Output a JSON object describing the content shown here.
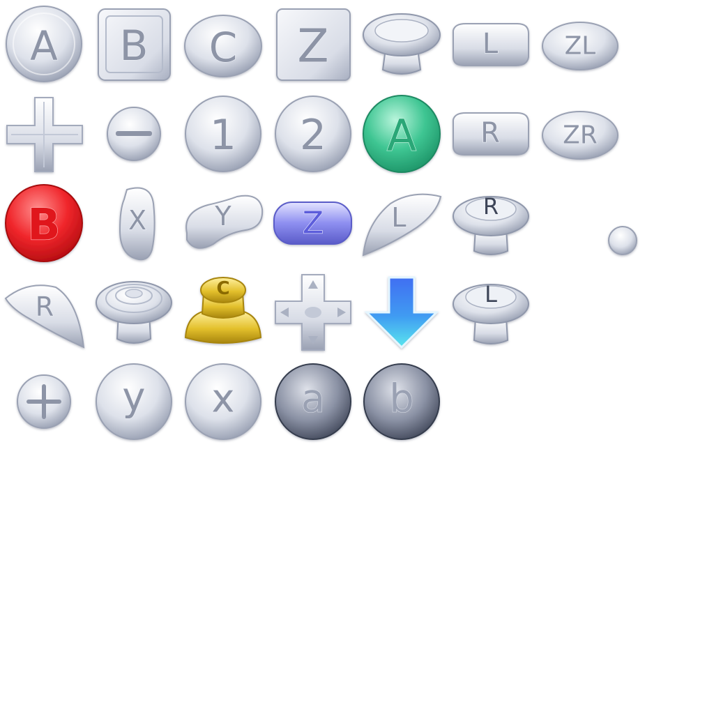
{
  "sheet": {
    "background": "#ffffff",
    "colors": {
      "silver": "#d9dde8",
      "silver_shade": "#8f97ab",
      "green": "#3ec592",
      "red": "#f0262b",
      "violet": "#8e8ff0",
      "yellow": "#e3c02c",
      "blue": "#3f86f2",
      "cyan": "#5ae6ee",
      "dark": "#4e5569"
    },
    "rows": [
      [
        {
          "name": "a-button-icon",
          "label": "A"
        },
        {
          "name": "b-square-button-icon",
          "label": "B"
        },
        {
          "name": "c-oval-button-icon",
          "label": "C"
        },
        {
          "name": "z-square-button-icon",
          "label": "Z"
        },
        {
          "name": "thumbstick-plain-icon",
          "label": ""
        },
        {
          "name": "l-shoulder-button-icon",
          "label": "L"
        },
        {
          "name": "zl-button-icon",
          "label": "ZL"
        }
      ],
      [
        {
          "name": "dpad-icon",
          "label": ""
        },
        {
          "name": "minus-button-icon",
          "label": ""
        },
        {
          "name": "one-button-icon",
          "label": "1"
        },
        {
          "name": "two-button-icon",
          "label": "2"
        },
        {
          "name": "a-green-button-icon",
          "label": "A"
        },
        {
          "name": "r-shoulder-button-icon",
          "label": "R"
        },
        {
          "name": "zr-button-icon",
          "label": "ZR"
        }
      ],
      [
        {
          "name": "b-red-button-icon",
          "label": "B"
        },
        {
          "name": "x-kidney-button-icon",
          "label": "X"
        },
        {
          "name": "y-kidney-button-icon",
          "label": "Y"
        },
        {
          "name": "z-violet-button-icon",
          "label": "Z"
        },
        {
          "name": "l-trigger-icon",
          "label": "L"
        },
        {
          "name": "r-stick-icon",
          "label": "R"
        },
        {
          "name": "small-dot-icon",
          "label": ""
        }
      ],
      [
        {
          "name": "r-trigger-icon",
          "label": "R"
        },
        {
          "name": "control-stick-icon",
          "label": ""
        },
        {
          "name": "c-stick-yellow-icon",
          "label": "C"
        },
        {
          "name": "dpad-arrows-icon",
          "label": ""
        },
        {
          "name": "down-arrow-icon",
          "label": ""
        },
        {
          "name": "l-stick-icon",
          "label": "L"
        }
      ],
      [
        {
          "name": "plus-button-icon",
          "label": ""
        },
        {
          "name": "y-lowercase-button-icon",
          "label": "y"
        },
        {
          "name": "x-lowercase-button-icon",
          "label": "x"
        },
        {
          "name": "a-dark-button-icon",
          "label": "a"
        },
        {
          "name": "b-dark-button-icon",
          "label": "b"
        }
      ]
    ]
  }
}
